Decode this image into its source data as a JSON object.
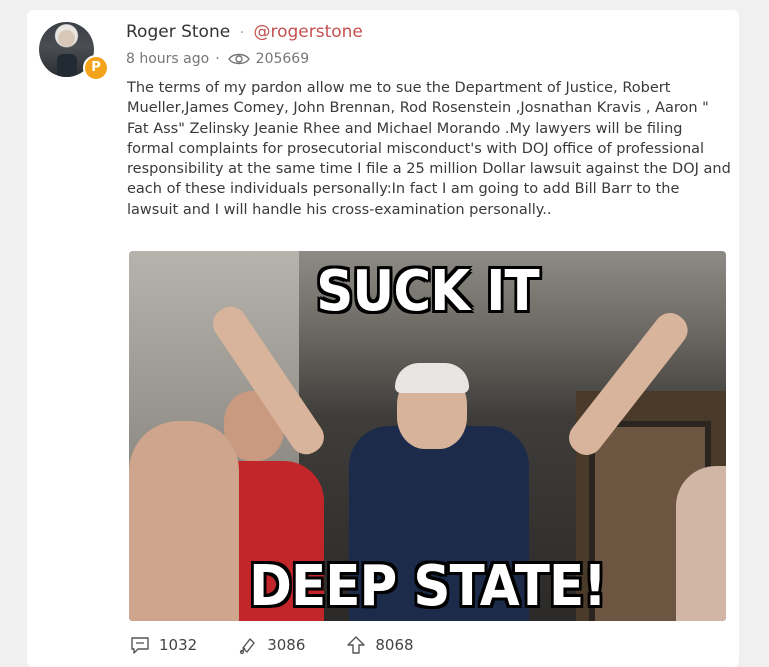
{
  "post": {
    "author_name": "Roger Stone",
    "handle": "@rogerstone",
    "separator": "·",
    "time_ago": "8 hours ago",
    "views": "205669",
    "body": "The terms of my pardon allow me to sue the Department of Justice, Robert Mueller,James Comey, John Brennan, Rod Rosenstein ,Josnathan Kravis , Aaron \" Fat Ass\" Zelinsky Jeanie Rhee and Michael Morando .My lawyers will be filing formal complaints for prosecutorial misconduct's with DOJ office of professional responsibility at the same time I file a 25 million Dollar lawsuit against the DOJ and each of these individuals personally:In fact I am going to add Bill Barr to the lawsuit and I will handle his cross-examination personally..",
    "badge_glyph": "P",
    "accent_color": "#c4514f",
    "badge_color": "#f3a41b"
  },
  "media": {
    "meme_top": "SUCK IT",
    "meme_bottom": "DEEP STATE!"
  },
  "actions": {
    "comments": {
      "count": "1032",
      "icon": "comment-icon"
    },
    "echoes": {
      "count": "3086",
      "icon": "echo-icon"
    },
    "upvotes": {
      "count": "8068",
      "icon": "upvote-icon"
    }
  }
}
